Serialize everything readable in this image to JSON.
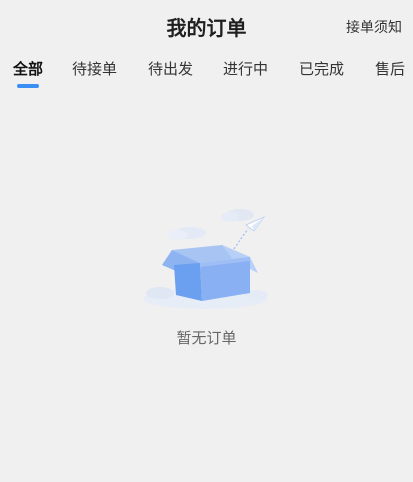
{
  "header": {
    "title": "我的订单",
    "notice_label": "接单须知"
  },
  "tabs": [
    {
      "label": "全部",
      "active": true
    },
    {
      "label": "待接单",
      "active": false
    },
    {
      "label": "待出发",
      "active": false
    },
    {
      "label": "进行中",
      "active": false
    },
    {
      "label": "已完成",
      "active": false
    },
    {
      "label": "售后",
      "active": false
    }
  ],
  "empty_state": {
    "icon": "empty-box-icon",
    "text": "暂无订单"
  },
  "colors": {
    "accent": "#3a8ff5",
    "background": "#f0f0f0"
  }
}
